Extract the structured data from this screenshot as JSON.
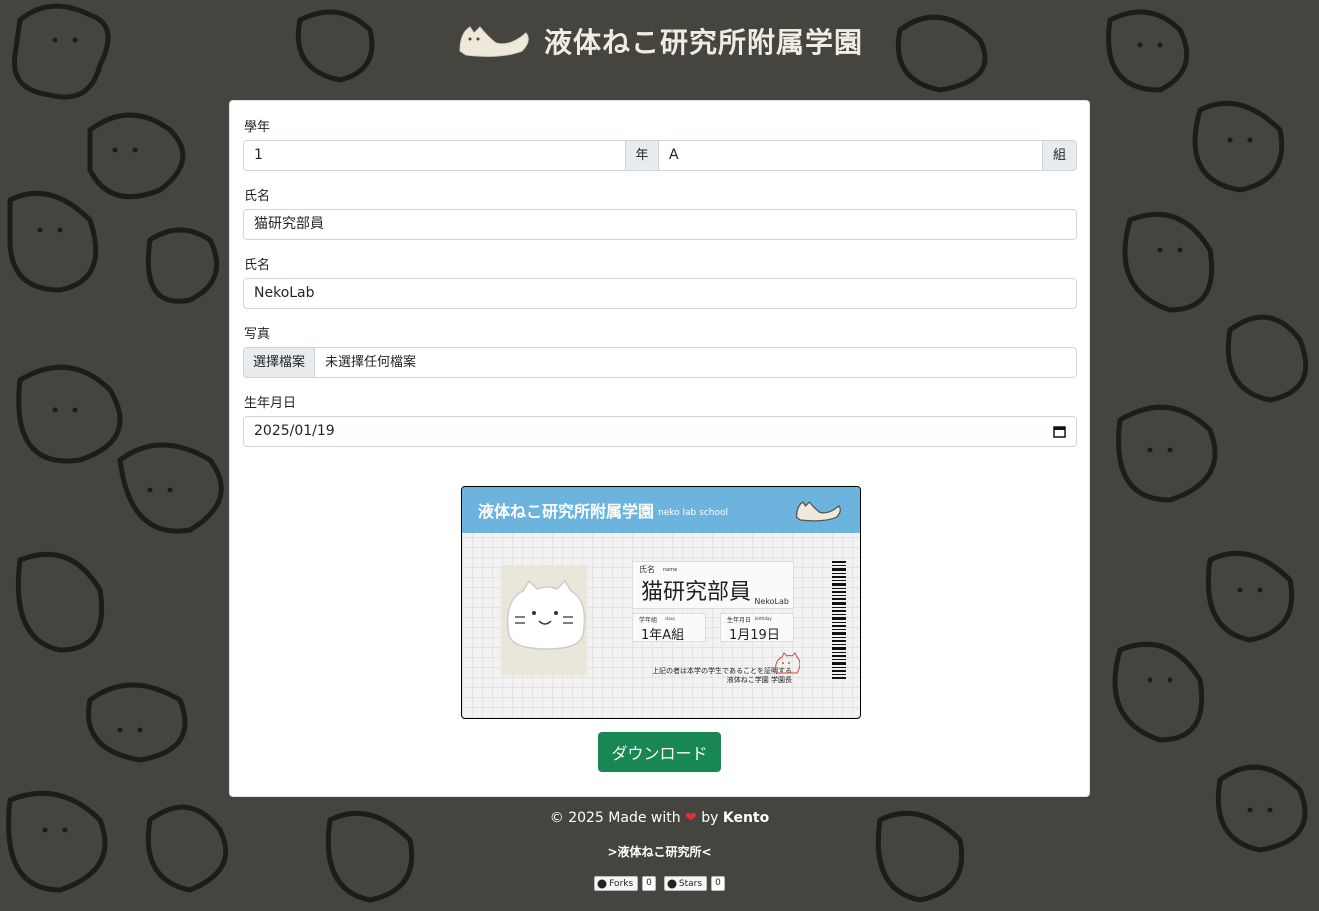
{
  "header": {
    "title": "液体ねこ研究所附属学園",
    "logo_icon": "cat-logo-icon"
  },
  "form": {
    "grade_label": "學年",
    "grade_value": "1",
    "grade_suffix": "年",
    "class_value": "A",
    "class_suffix": "組",
    "name_jp_label": "氏名",
    "name_jp_value": "猫研究部員",
    "name_en_label": "氏名",
    "name_en_value": "NekoLab",
    "photo_label": "写真",
    "photo_button": "選擇檔案",
    "photo_status": "未選擇任何檔案",
    "birthday_label": "生年月日",
    "birthday_value": "2025/01/19"
  },
  "id_card": {
    "school_name": "液体ねこ研究所附属学園",
    "school_name_en": "neko lab school",
    "name_label": "氏名",
    "name_label_en": "name",
    "name_jp": "猫研究部員",
    "name_en": "NekoLab",
    "grade_label": "学年組",
    "grade_label_en": "class",
    "grade_value": "1年A組",
    "birthday_label": "生年月日",
    "birthday_label_en": "birthday",
    "birthday_value": "1月19日",
    "notice_line1": "上記の者は本学の学生であることを証明する",
    "notice_line2": "液体ねこ学園 学園長"
  },
  "download_button": "ダウンロード",
  "footer": {
    "credit_prefix": "© 2025 Made with",
    "credit_by": "by",
    "credit_author": "Kento",
    "lab_link": ">液体ねこ研究所<",
    "forks_label": "Forks",
    "forks_count": "0",
    "stars_label": "Stars",
    "stars_count": "0"
  },
  "colors": {
    "background": "#45443f",
    "card_header": "#6cb4de",
    "download_button": "#198754",
    "heart": "#e0303a"
  }
}
